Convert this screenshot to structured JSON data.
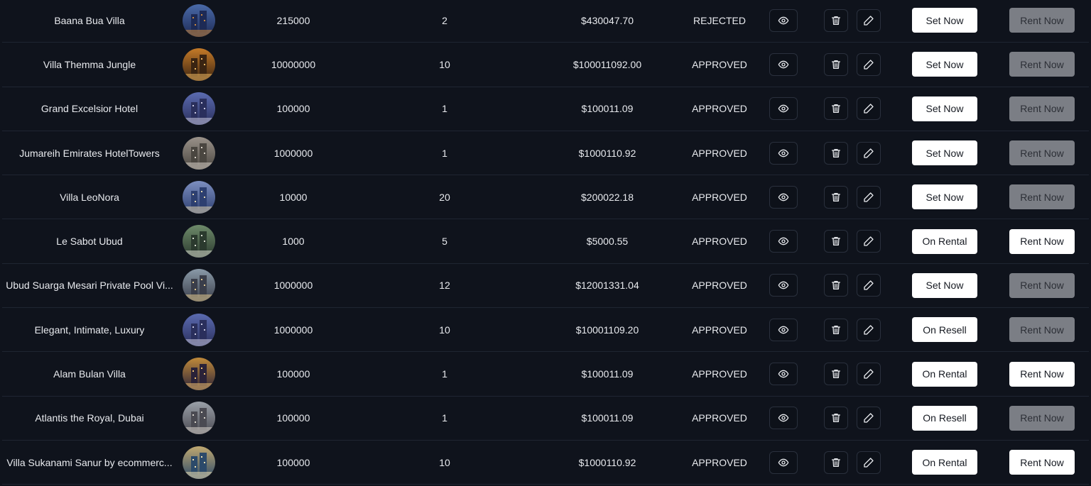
{
  "properties": [
    {
      "name": "Baana Bua Villa",
      "units": "215000",
      "share": "2",
      "price": "$430047.70",
      "status": "REJECTED",
      "set_label": "Set Now",
      "rent_label": "Rent Now",
      "rent_enabled": false
    },
    {
      "name": "Villa Themma Jungle",
      "units": "10000000",
      "share": "10",
      "price": "$100011092.00",
      "status": "APPROVED",
      "set_label": "Set Now",
      "rent_label": "Rent Now",
      "rent_enabled": false
    },
    {
      "name": "Grand Excelsior Hotel",
      "units": "100000",
      "share": "1",
      "price": "$100011.09",
      "status": "APPROVED",
      "set_label": "Set Now",
      "rent_label": "Rent Now",
      "rent_enabled": false
    },
    {
      "name": "Jumareih Emirates HotelTowers",
      "units": "1000000",
      "share": "1",
      "price": "$1000110.92",
      "status": "APPROVED",
      "set_label": "Set Now",
      "rent_label": "Rent Now",
      "rent_enabled": false
    },
    {
      "name": "Villa LeoNora",
      "units": "10000",
      "share": "20",
      "price": "$200022.18",
      "status": "APPROVED",
      "set_label": "Set Now",
      "rent_label": "Rent Now",
      "rent_enabled": false
    },
    {
      "name": "Le Sabot Ubud",
      "units": "1000",
      "share": "5",
      "price": "$5000.55",
      "status": "APPROVED",
      "set_label": "On Rental",
      "rent_label": "Rent Now",
      "rent_enabled": true
    },
    {
      "name": "Ubud Suarga Mesari Private Pool Vi...",
      "units": "1000000",
      "share": "12",
      "price": "$12001331.04",
      "status": "APPROVED",
      "set_label": "Set Now",
      "rent_label": "Rent Now",
      "rent_enabled": false
    },
    {
      "name": "Elegant, Intimate, Luxury",
      "units": "1000000",
      "share": "10",
      "price": "$10001109.20",
      "status": "APPROVED",
      "set_label": "On Resell",
      "rent_label": "Rent Now",
      "rent_enabled": false
    },
    {
      "name": "Alam Bulan Villa",
      "units": "100000",
      "share": "1",
      "price": "$100011.09",
      "status": "APPROVED",
      "set_label": "On Rental",
      "rent_label": "Rent Now",
      "rent_enabled": true
    },
    {
      "name": "Atlantis the Royal, Dubai",
      "units": "100000",
      "share": "1",
      "price": "$100011.09",
      "status": "APPROVED",
      "set_label": "On Resell",
      "rent_label": "Rent Now",
      "rent_enabled": false
    },
    {
      "name": "Villa Sukanami Sanur by ecommerc...",
      "units": "100000",
      "share": "10",
      "price": "$1000110.92",
      "status": "APPROVED",
      "set_label": "On Rental",
      "rent_label": "Rent Now",
      "rent_enabled": true
    }
  ],
  "thumbnail_palettes": [
    [
      "#1d2a55",
      "#4a6aa8",
      "#c9873d"
    ],
    [
      "#3a2412",
      "#c47a28",
      "#f0b860"
    ],
    [
      "#2a2f5c",
      "#5b6bb0",
      "#c8c8e0"
    ],
    [
      "#4a4640",
      "#9a928a",
      "#d9d2c8"
    ],
    [
      "#2d3f70",
      "#7d8fc0",
      "#e0d4b0"
    ],
    [
      "#2b3a2e",
      "#6e8a6a",
      "#d8dcd0"
    ],
    [
      "#3a3e4a",
      "#8a9aa8",
      "#e0c890"
    ],
    [
      "#2a2f5c",
      "#5b6bb0",
      "#c8c8e0"
    ],
    [
      "#2a2238",
      "#c08a3a",
      "#f0c070"
    ],
    [
      "#4a4a52",
      "#9aa0a8",
      "#d8d4cc"
    ],
    [
      "#2c4a6a",
      "#c0a870",
      "#f0e0b0"
    ]
  ],
  "icons": {
    "view": "eye-icon",
    "delete": "trash-icon",
    "edit": "pencil-icon"
  }
}
